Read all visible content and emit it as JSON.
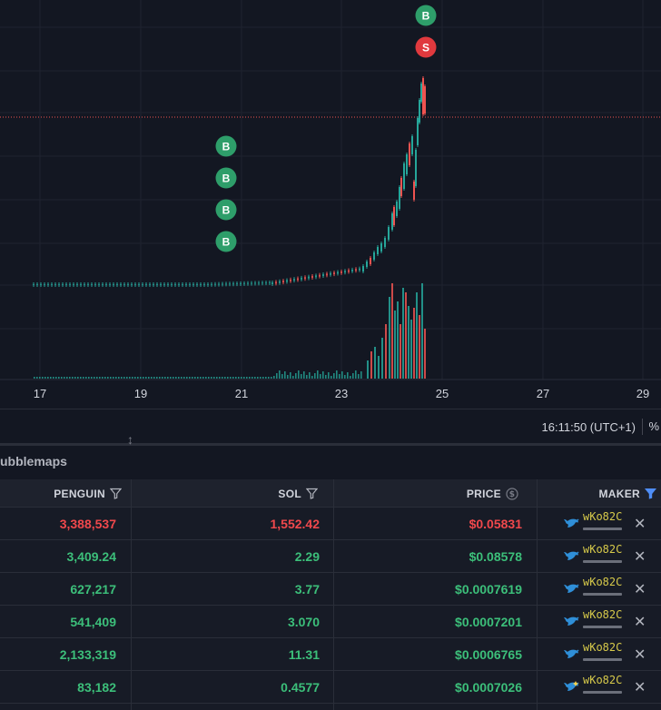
{
  "chart_data": {
    "type": "candlestick",
    "x_ticks": [
      "17",
      "19",
      "21",
      "23",
      "25",
      "27",
      "29"
    ],
    "buy_label": "B",
    "sell_label": "S"
  },
  "status": {
    "clock": "16:11:50 (UTC+1)",
    "percent": "%"
  },
  "panel": {
    "tab": "ubblemaps"
  },
  "table": {
    "headers": {
      "token": "PENGUIN",
      "sol": "SOL",
      "price": "PRICE",
      "maker": "MAKER"
    },
    "rows": [
      {
        "side": "sell",
        "token": "3,388,537",
        "sol": "1,552.42",
        "price": "$0.05831",
        "maker": "wKo82C",
        "close": "✕"
      },
      {
        "side": "buy",
        "token": "3,409.24",
        "sol": "2.29",
        "price": "$0.08578",
        "maker": "wKo82C",
        "close": "✕"
      },
      {
        "side": "buy",
        "token": "627,217",
        "sol": "3.77",
        "price": "$0.0007619",
        "maker": "wKo82C",
        "close": "✕"
      },
      {
        "side": "buy",
        "token": "541,409",
        "sol": "3.070",
        "price": "$0.0007201",
        "maker": "wKo82C",
        "close": "✕"
      },
      {
        "side": "buy",
        "token": "2,133,319",
        "sol": "11.31",
        "price": "$0.0006765",
        "maker": "wKo82C",
        "close": "✕"
      },
      {
        "side": "buy",
        "token": "83,182",
        "sol": "0.4577",
        "price": "$0.0007026",
        "maker": "wKo82C",
        "close": "✕"
      }
    ]
  },
  "colors": {
    "up": "#26a69a",
    "down": "#ef5350",
    "buy_marker": "#2e9e6a",
    "sell_marker": "#e0393e",
    "maker": "#d6c94a",
    "whale": "#2f8fd8"
  },
  "icons": {
    "filter": "filter-icon",
    "sol_coin": "dollar-coin-icon",
    "whale": "whale-icon",
    "close": "close-icon",
    "resize": "resize-icon"
  }
}
